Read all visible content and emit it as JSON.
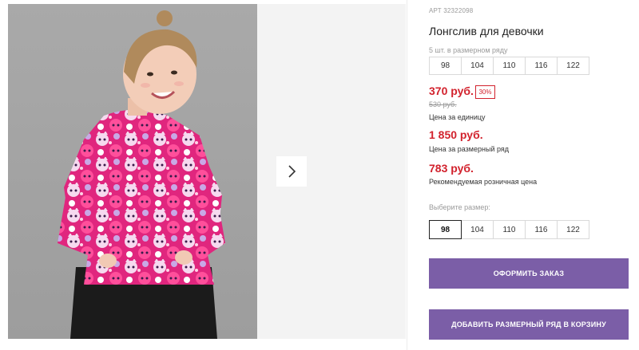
{
  "gallery": {
    "next_icon": "chevron-right-icon"
  },
  "product": {
    "article": "АРТ 32322098",
    "title": "Лонгслив для девочки",
    "size_row_caption": "5 шт. в размерном ряду",
    "size_row": [
      "98",
      "104",
      "110",
      "116",
      "122"
    ],
    "price": "370 руб.",
    "discount": "30%",
    "old_price": "530 руб.",
    "unit_caption": "Цена за единицу",
    "row_price": "1 850 руб.",
    "row_price_caption": "Цена за размерный ряд",
    "retail_price": "783 руб.",
    "retail_caption": "Рекомендуемая розничная цена",
    "choose_caption": "Выберите размер:",
    "sizes": [
      "98",
      "104",
      "110",
      "116",
      "122"
    ],
    "selected_size": "98"
  },
  "actions": {
    "order_label": "ОФОРМИТЬ ЗАКАЗ",
    "add_row_label": "ДОБАВИТЬ РАЗМЕРНЫЙ РЯД В КОРЗИНУ"
  },
  "colors": {
    "accent": "#7b5ea7",
    "price_red": "#d2222d"
  }
}
